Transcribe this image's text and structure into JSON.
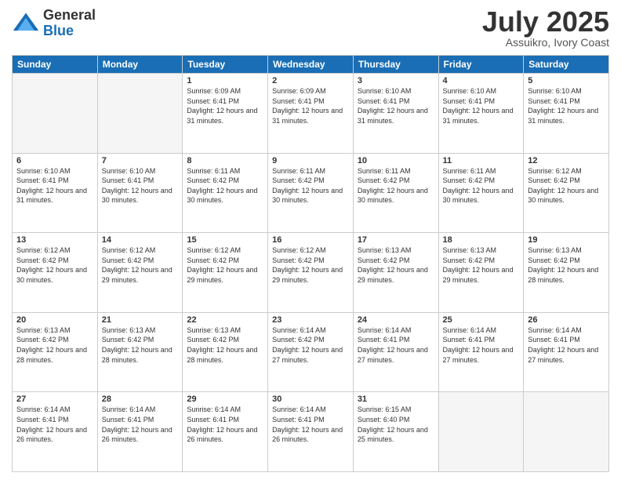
{
  "logo": {
    "general": "General",
    "blue": "Blue"
  },
  "header": {
    "month": "July 2025",
    "location": "Assuikro, Ivory Coast"
  },
  "days_of_week": [
    "Sunday",
    "Monday",
    "Tuesday",
    "Wednesday",
    "Thursday",
    "Friday",
    "Saturday"
  ],
  "weeks": [
    [
      {
        "day": "",
        "sunrise": "",
        "sunset": "",
        "daylight": ""
      },
      {
        "day": "",
        "sunrise": "",
        "sunset": "",
        "daylight": ""
      },
      {
        "day": "1",
        "sunrise": "Sunrise: 6:09 AM",
        "sunset": "Sunset: 6:41 PM",
        "daylight": "Daylight: 12 hours and 31 minutes."
      },
      {
        "day": "2",
        "sunrise": "Sunrise: 6:09 AM",
        "sunset": "Sunset: 6:41 PM",
        "daylight": "Daylight: 12 hours and 31 minutes."
      },
      {
        "day": "3",
        "sunrise": "Sunrise: 6:10 AM",
        "sunset": "Sunset: 6:41 PM",
        "daylight": "Daylight: 12 hours and 31 minutes."
      },
      {
        "day": "4",
        "sunrise": "Sunrise: 6:10 AM",
        "sunset": "Sunset: 6:41 PM",
        "daylight": "Daylight: 12 hours and 31 minutes."
      },
      {
        "day": "5",
        "sunrise": "Sunrise: 6:10 AM",
        "sunset": "Sunset: 6:41 PM",
        "daylight": "Daylight: 12 hours and 31 minutes."
      }
    ],
    [
      {
        "day": "6",
        "sunrise": "Sunrise: 6:10 AM",
        "sunset": "Sunset: 6:41 PM",
        "daylight": "Daylight: 12 hours and 31 minutes."
      },
      {
        "day": "7",
        "sunrise": "Sunrise: 6:10 AM",
        "sunset": "Sunset: 6:41 PM",
        "daylight": "Daylight: 12 hours and 30 minutes."
      },
      {
        "day": "8",
        "sunrise": "Sunrise: 6:11 AM",
        "sunset": "Sunset: 6:42 PM",
        "daylight": "Daylight: 12 hours and 30 minutes."
      },
      {
        "day": "9",
        "sunrise": "Sunrise: 6:11 AM",
        "sunset": "Sunset: 6:42 PM",
        "daylight": "Daylight: 12 hours and 30 minutes."
      },
      {
        "day": "10",
        "sunrise": "Sunrise: 6:11 AM",
        "sunset": "Sunset: 6:42 PM",
        "daylight": "Daylight: 12 hours and 30 minutes."
      },
      {
        "day": "11",
        "sunrise": "Sunrise: 6:11 AM",
        "sunset": "Sunset: 6:42 PM",
        "daylight": "Daylight: 12 hours and 30 minutes."
      },
      {
        "day": "12",
        "sunrise": "Sunrise: 6:12 AM",
        "sunset": "Sunset: 6:42 PM",
        "daylight": "Daylight: 12 hours and 30 minutes."
      }
    ],
    [
      {
        "day": "13",
        "sunrise": "Sunrise: 6:12 AM",
        "sunset": "Sunset: 6:42 PM",
        "daylight": "Daylight: 12 hours and 30 minutes."
      },
      {
        "day": "14",
        "sunrise": "Sunrise: 6:12 AM",
        "sunset": "Sunset: 6:42 PM",
        "daylight": "Daylight: 12 hours and 29 minutes."
      },
      {
        "day": "15",
        "sunrise": "Sunrise: 6:12 AM",
        "sunset": "Sunset: 6:42 PM",
        "daylight": "Daylight: 12 hours and 29 minutes."
      },
      {
        "day": "16",
        "sunrise": "Sunrise: 6:12 AM",
        "sunset": "Sunset: 6:42 PM",
        "daylight": "Daylight: 12 hours and 29 minutes."
      },
      {
        "day": "17",
        "sunrise": "Sunrise: 6:13 AM",
        "sunset": "Sunset: 6:42 PM",
        "daylight": "Daylight: 12 hours and 29 minutes."
      },
      {
        "day": "18",
        "sunrise": "Sunrise: 6:13 AM",
        "sunset": "Sunset: 6:42 PM",
        "daylight": "Daylight: 12 hours and 29 minutes."
      },
      {
        "day": "19",
        "sunrise": "Sunrise: 6:13 AM",
        "sunset": "Sunset: 6:42 PM",
        "daylight": "Daylight: 12 hours and 28 minutes."
      }
    ],
    [
      {
        "day": "20",
        "sunrise": "Sunrise: 6:13 AM",
        "sunset": "Sunset: 6:42 PM",
        "daylight": "Daylight: 12 hours and 28 minutes."
      },
      {
        "day": "21",
        "sunrise": "Sunrise: 6:13 AM",
        "sunset": "Sunset: 6:42 PM",
        "daylight": "Daylight: 12 hours and 28 minutes."
      },
      {
        "day": "22",
        "sunrise": "Sunrise: 6:13 AM",
        "sunset": "Sunset: 6:42 PM",
        "daylight": "Daylight: 12 hours and 28 minutes."
      },
      {
        "day": "23",
        "sunrise": "Sunrise: 6:14 AM",
        "sunset": "Sunset: 6:42 PM",
        "daylight": "Daylight: 12 hours and 27 minutes."
      },
      {
        "day": "24",
        "sunrise": "Sunrise: 6:14 AM",
        "sunset": "Sunset: 6:41 PM",
        "daylight": "Daylight: 12 hours and 27 minutes."
      },
      {
        "day": "25",
        "sunrise": "Sunrise: 6:14 AM",
        "sunset": "Sunset: 6:41 PM",
        "daylight": "Daylight: 12 hours and 27 minutes."
      },
      {
        "day": "26",
        "sunrise": "Sunrise: 6:14 AM",
        "sunset": "Sunset: 6:41 PM",
        "daylight": "Daylight: 12 hours and 27 minutes."
      }
    ],
    [
      {
        "day": "27",
        "sunrise": "Sunrise: 6:14 AM",
        "sunset": "Sunset: 6:41 PM",
        "daylight": "Daylight: 12 hours and 26 minutes."
      },
      {
        "day": "28",
        "sunrise": "Sunrise: 6:14 AM",
        "sunset": "Sunset: 6:41 PM",
        "daylight": "Daylight: 12 hours and 26 minutes."
      },
      {
        "day": "29",
        "sunrise": "Sunrise: 6:14 AM",
        "sunset": "Sunset: 6:41 PM",
        "daylight": "Daylight: 12 hours and 26 minutes."
      },
      {
        "day": "30",
        "sunrise": "Sunrise: 6:14 AM",
        "sunset": "Sunset: 6:41 PM",
        "daylight": "Daylight: 12 hours and 26 minutes."
      },
      {
        "day": "31",
        "sunrise": "Sunrise: 6:15 AM",
        "sunset": "Sunset: 6:40 PM",
        "daylight": "Daylight: 12 hours and 25 minutes."
      },
      {
        "day": "",
        "sunrise": "",
        "sunset": "",
        "daylight": ""
      },
      {
        "day": "",
        "sunrise": "",
        "sunset": "",
        "daylight": ""
      }
    ]
  ]
}
